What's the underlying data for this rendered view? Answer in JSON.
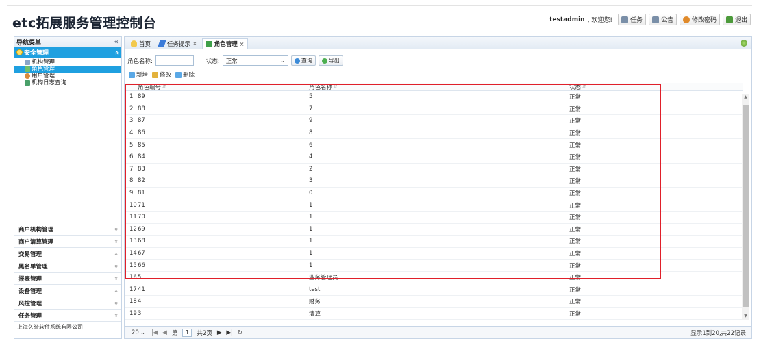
{
  "header": {
    "title": "etc拓展服务管理控制台",
    "user": "testadmin",
    "welcome": ", 欢迎您!",
    "buttons": [
      {
        "label": "任务",
        "icon": "task-icon",
        "color": "#7a8fa8"
      },
      {
        "label": "公告",
        "icon": "notice-icon",
        "color": "#7a8fa8"
      },
      {
        "label": "修改密码",
        "icon": "user-key-icon",
        "color": "#e08a2a"
      },
      {
        "label": "退出",
        "icon": "logout-icon",
        "color": "#4c9a3a"
      }
    ]
  },
  "nav": {
    "title": "导航菜单",
    "collapse": "«",
    "active_section": {
      "label": "安全管理",
      "chevron": "«"
    },
    "items": [
      {
        "label": "机构管理",
        "icon": "org-icon",
        "active": false
      },
      {
        "label": "角色管理",
        "icon": "role-icon",
        "active": true
      },
      {
        "label": "用户管理",
        "icon": "user-icon",
        "active": false
      },
      {
        "label": "机构日志查询",
        "icon": "log-icon",
        "active": false
      }
    ],
    "groups": [
      {
        "label": "商户机构管理",
        "chev": "»"
      },
      {
        "label": "商户清算管理",
        "chev": "»"
      },
      {
        "label": "交易管理",
        "chev": "»"
      },
      {
        "label": "黑名单管理",
        "chev": "»"
      },
      {
        "label": "报表管理",
        "chev": "»"
      },
      {
        "label": "设备管理",
        "chev": "»"
      },
      {
        "label": "风控管理",
        "chev": "»"
      },
      {
        "label": "任务管理",
        "chev": "»"
      }
    ],
    "footer": "上海久誉软件系统有限公司"
  },
  "tabs": [
    {
      "label": "首页",
      "closable": false,
      "active": false,
      "icon": "home-icon"
    },
    {
      "label": "任务提示",
      "closable": true,
      "active": false,
      "icon": "pencil-icon"
    },
    {
      "label": "角色管理",
      "closable": true,
      "active": true,
      "icon": "hierarchy-icon"
    }
  ],
  "tab_close": "×",
  "filters": {
    "role_name_label": "角色名称:",
    "status_label": "状态:",
    "status_value": "正常",
    "query": "查询",
    "export": "导出"
  },
  "actions": {
    "add": "新增",
    "edit": "修改",
    "delete": "删除"
  },
  "grid": {
    "columns": {
      "no": "角色编号",
      "name": "角色名称",
      "state": "状态"
    },
    "rows": [
      {
        "rn": "1",
        "no": "89",
        "name": "5",
        "state": "正常"
      },
      {
        "rn": "2",
        "no": "88",
        "name": "7",
        "state": "正常"
      },
      {
        "rn": "3",
        "no": "87",
        "name": "9",
        "state": "正常"
      },
      {
        "rn": "4",
        "no": "86",
        "name": "8",
        "state": "正常"
      },
      {
        "rn": "5",
        "no": "85",
        "name": "6",
        "state": "正常"
      },
      {
        "rn": "6",
        "no": "84",
        "name": "4",
        "state": "正常"
      },
      {
        "rn": "7",
        "no": "83",
        "name": "2",
        "state": "正常"
      },
      {
        "rn": "8",
        "no": "82",
        "name": "3",
        "state": "正常"
      },
      {
        "rn": "9",
        "no": "81",
        "name": "0",
        "state": "正常"
      },
      {
        "rn": "10",
        "no": "71",
        "name": "1",
        "state": "正常"
      },
      {
        "rn": "11",
        "no": "70",
        "name": "1",
        "state": "正常"
      },
      {
        "rn": "12",
        "no": "69",
        "name": "1",
        "state": "正常"
      },
      {
        "rn": "13",
        "no": "68",
        "name": "1",
        "state": "正常"
      },
      {
        "rn": "14",
        "no": "67",
        "name": "1",
        "state": "正常"
      },
      {
        "rn": "15",
        "no": "66",
        "name": "1",
        "state": "正常"
      },
      {
        "rn": "16",
        "no": "5",
        "name": "业务管理员",
        "state": "正常"
      },
      {
        "rn": "17",
        "no": "41",
        "name": "test",
        "state": "正常"
      },
      {
        "rn": "18",
        "no": "4",
        "name": "财务",
        "state": "正常"
      },
      {
        "rn": "19",
        "no": "3",
        "name": "清算",
        "state": "正常"
      }
    ]
  },
  "pager": {
    "page_size": "20",
    "page_prefix": "第",
    "page": "1",
    "total_pages": "共2页",
    "info": "显示1到20,共22记录"
  }
}
